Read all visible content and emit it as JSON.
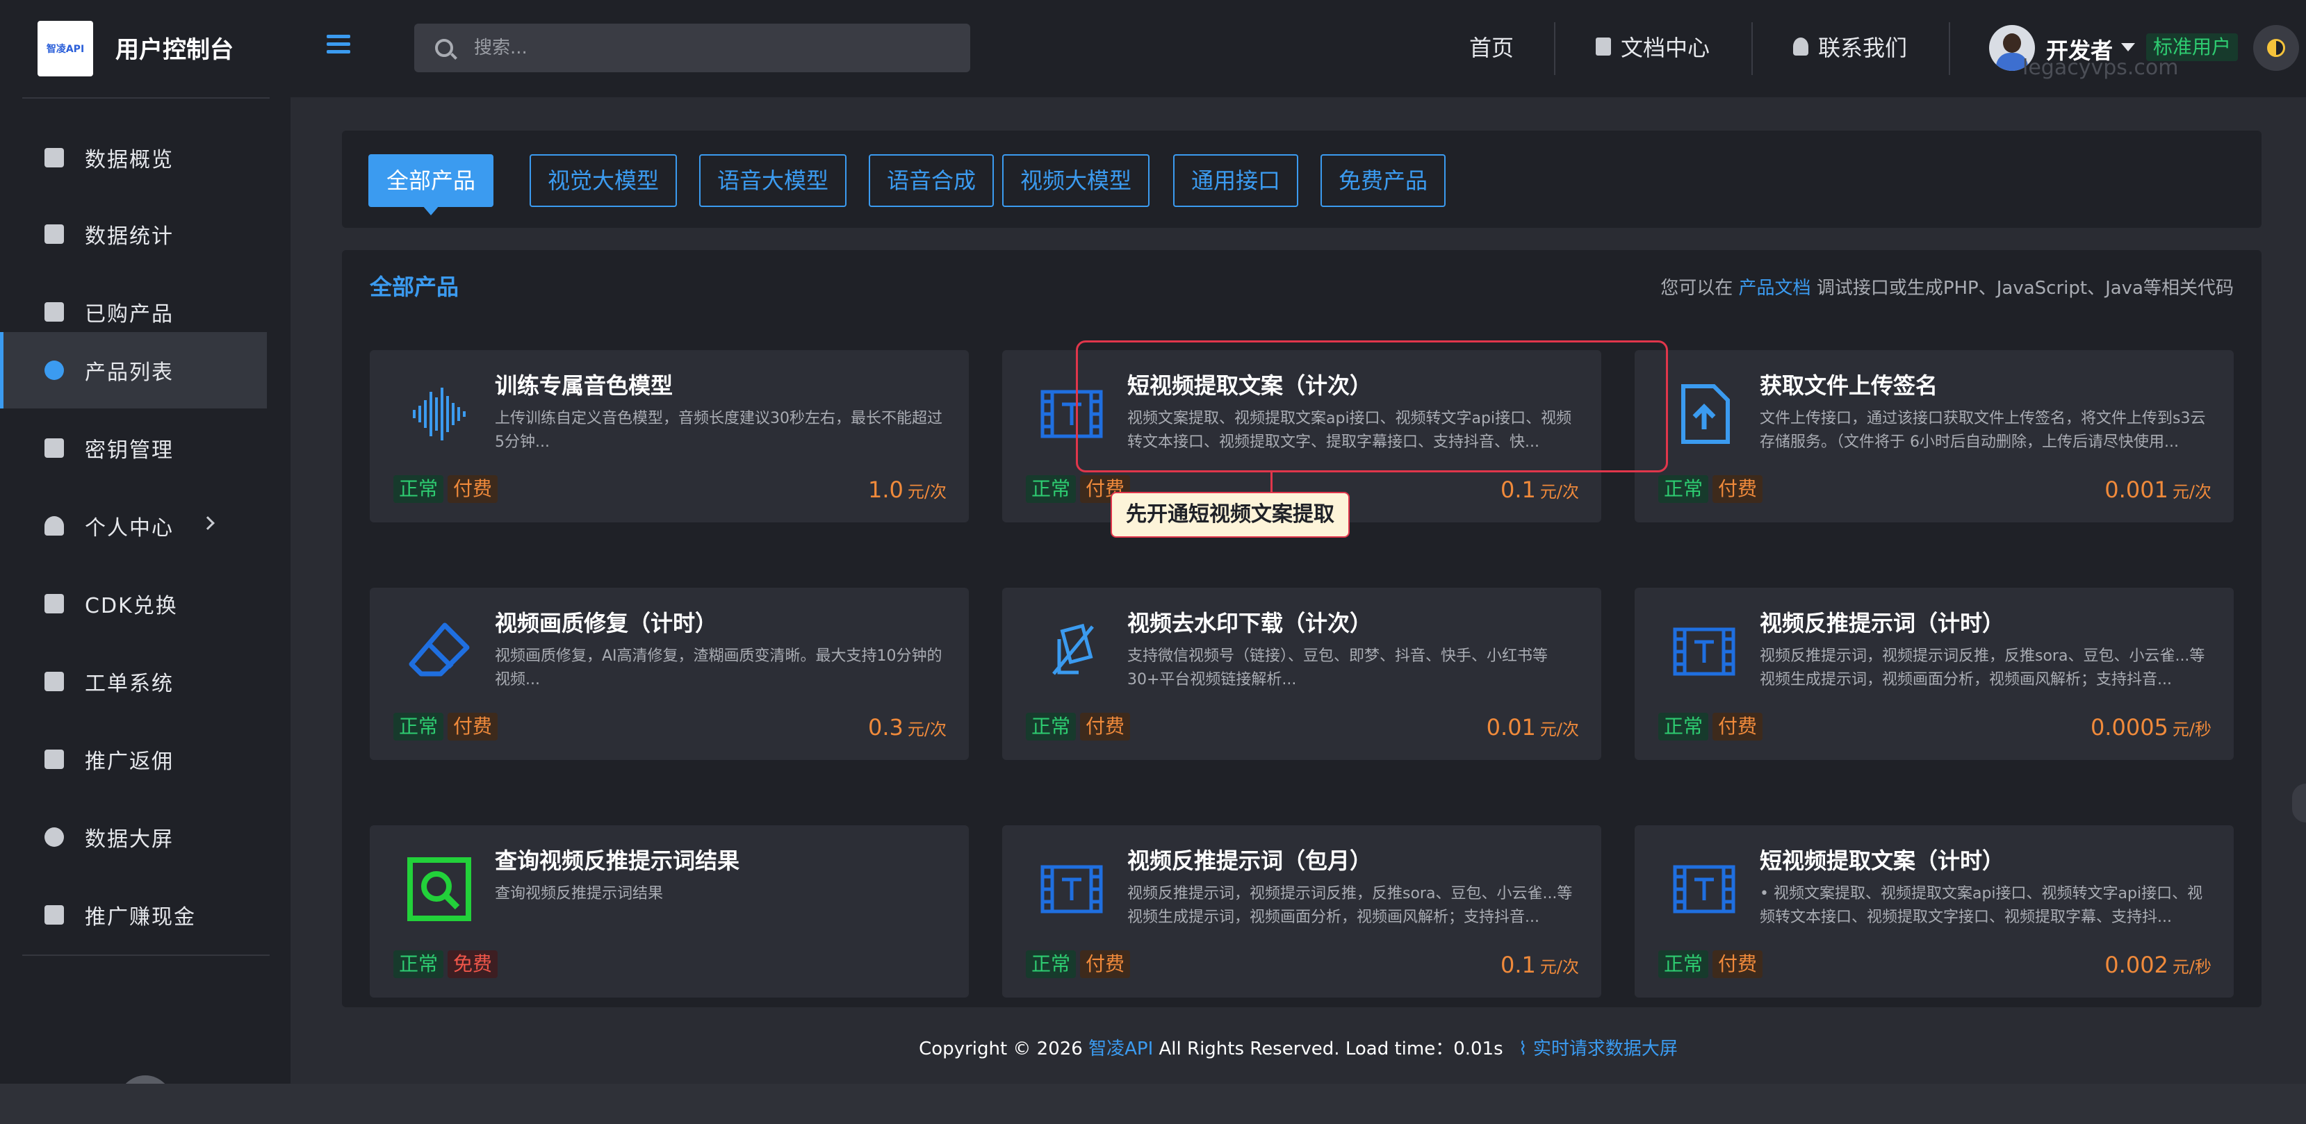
{
  "header": {
    "logo_text": "智凌API",
    "app_title": "用户控制台",
    "search_placeholder": "搜索...",
    "nav": [
      "首页",
      "文档中心",
      "联系我们"
    ],
    "user_name": "开发者",
    "user_role": "标准用户",
    "watermark": "legacyvps.com"
  },
  "sidebar": {
    "items": [
      {
        "label": "数据概览",
        "icon": "chart-area-icon"
      },
      {
        "label": "数据统计",
        "icon": "line-chart-icon"
      },
      {
        "label": "已购产品",
        "icon": "cart-icon"
      },
      {
        "label": "产品列表",
        "icon": "product-icon",
        "active": true
      },
      {
        "label": "密钥管理",
        "icon": "key-icon"
      },
      {
        "label": "个人中心",
        "icon": "user-icon",
        "has_arrow": true
      },
      {
        "label": "CDK兑换",
        "icon": "key-icon"
      },
      {
        "label": "工单系统",
        "icon": "pencil-icon"
      },
      {
        "label": "推广返佣",
        "icon": "users-icon"
      },
      {
        "label": "数据大屏",
        "icon": "cloud-icon"
      },
      {
        "label": "推广赚现金",
        "icon": "hand-coin-icon"
      }
    ]
  },
  "filters": [
    "全部产品",
    "视觉大模型",
    "语音大模型",
    "语音合成",
    "视频大模型",
    "通用接口",
    "免费产品"
  ],
  "list": {
    "title": "全部产品",
    "hint_prefix": "您可以在",
    "hint_link": "产品文档",
    "hint_suffix": "调试接口或生成PHP、JavaScript、Java等相关代码"
  },
  "cards": [
    {
      "title": "训练专属音色模型",
      "desc": "上传训练自定义音色模型，音频长度建议30秒左右，最长不能超过5分钟...",
      "status": "正常",
      "billing": "付费",
      "price": "1.0",
      "unit": "元/次",
      "icon": "waveform-icon",
      "icon_color": "#3b9bf0"
    },
    {
      "title": "短视频提取文案（计次）",
      "desc": "视频文案提取、视频提取文案api接口、视频转文字api接口、视频转文本接口、视频提取文字、提取字幕接口、支持抖音、快...",
      "status": "正常",
      "billing": "付费",
      "price": "0.1",
      "unit": "元/次",
      "icon": "video-text-icon",
      "icon_color": "#1f6fe0"
    },
    {
      "title": "获取文件上传签名",
      "desc": "文件上传接口，通过该接口获取文件上传签名，将文件上传到s3云存储服务。（文件将于 6小时后自动删除，上传后请尽快使用...",
      "status": "正常",
      "billing": "付费",
      "price": "0.001",
      "unit": "元/次",
      "icon": "file-upload-icon",
      "icon_color": "#3b9bf0"
    },
    {
      "title": "视频画质修复（计时）",
      "desc": "视频画质修复，AI高清修复，渣糊画质变清晰。最大支持10分钟的视频...",
      "status": "正常",
      "billing": "付费",
      "price": "0.3",
      "unit": "元/次",
      "icon": "eraser-icon",
      "icon_color": "#1f6fe0"
    },
    {
      "title": "视频去水印下载（计次）",
      "desc": "支持微信视频号（链接）、豆包、即梦、抖音、快手、小红书等30+平台视频链接解析...",
      "status": "正常",
      "billing": "付费",
      "price": "0.01",
      "unit": "元/次",
      "icon": "watermark-remove-icon",
      "icon_color": "#3b9bf0"
    },
    {
      "title": "视频反推提示词（计时）",
      "desc": "视频反推提示词，视频提示词反推，反推sora、豆包、小云雀...等视频生成提示词，视频画面分析，视频画风解析；支持抖音...",
      "status": "正常",
      "billing": "付费",
      "price": "0.0005",
      "unit": "元/秒",
      "icon": "video-text-icon",
      "icon_color": "#1f6fe0"
    },
    {
      "title": "查询视频反推提示词结果",
      "desc": "查询视频反推提示词结果",
      "status": "正常",
      "billing": "免费",
      "price": "",
      "unit": "",
      "icon": "search-result-icon",
      "icon_color": "#22d13a"
    },
    {
      "title": "视频反推提示词（包月）",
      "desc": "视频反推提示词，视频提示词反推，反推sora、豆包、小云雀...等视频生成提示词，视频画面分析，视频画风解析；支持抖音...",
      "status": "正常",
      "billing": "付费",
      "price": "0.1",
      "unit": "元/次",
      "icon": "video-text-icon",
      "icon_color": "#1f6fe0"
    },
    {
      "title": "短视频提取文案（计时）",
      "desc": "• 视频文案提取、视频提取文案api接口、视频转文字api接口、视频转文本接口、视频提取文字接口、视频提取字幕、支持抖...",
      "status": "正常",
      "billing": "付费",
      "price": "0.002",
      "unit": "元/秒",
      "icon": "video-text-icon",
      "icon_color": "#1f6fe0"
    }
  ],
  "tooltip": "先开通短视频文案提取",
  "footer": {
    "copyright_prefix": "Copyright © 2026",
    "brand": "智凌API",
    "rights": "All Rights Reserved. Load time：0.01s",
    "live_link": "实时请求数据大屏"
  },
  "colors": {
    "accent": "#3b9bf0",
    "success": "#2ecc71",
    "warning": "#f08a3b",
    "danger": "#e0364b"
  }
}
